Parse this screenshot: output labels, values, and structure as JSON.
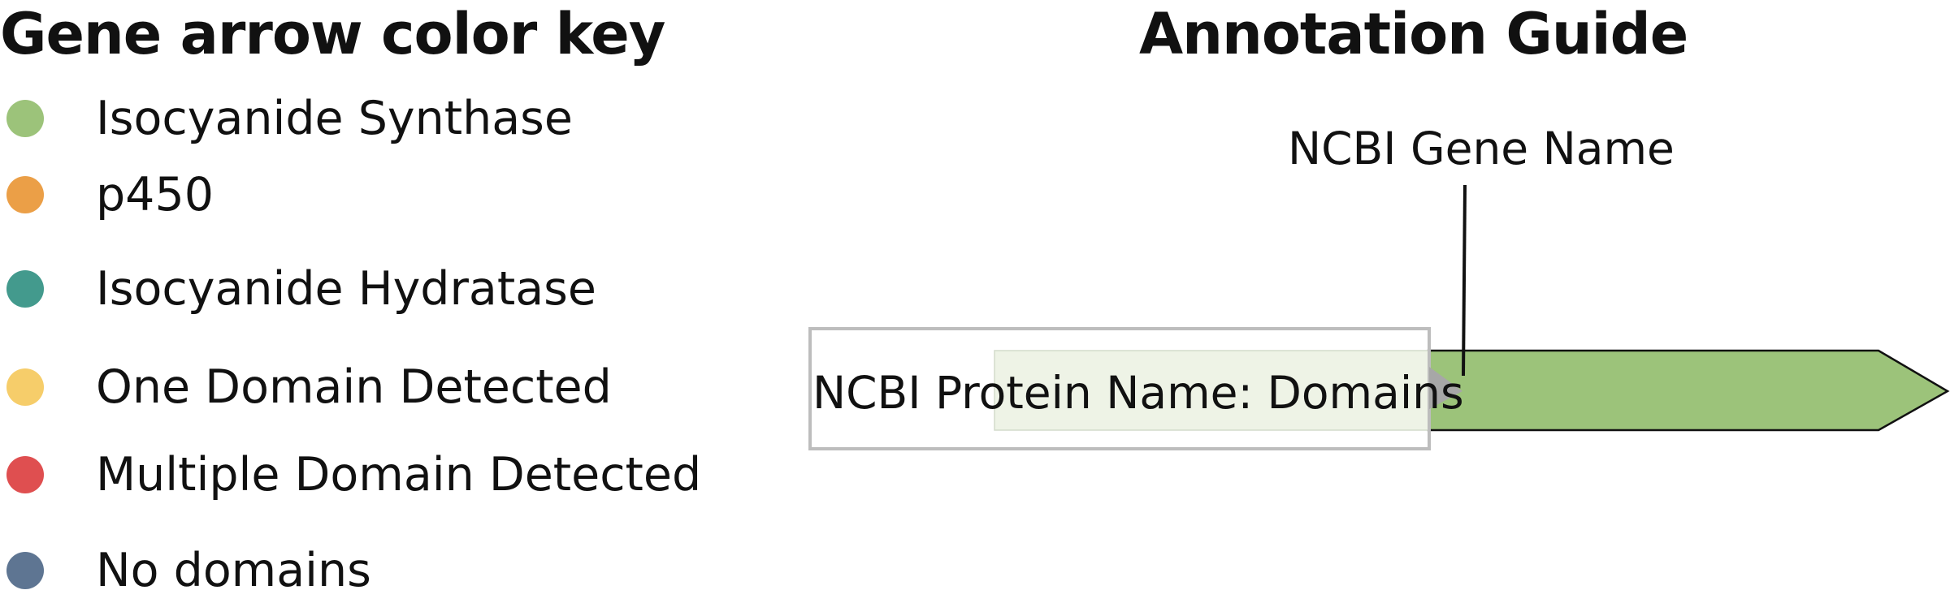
{
  "legend": {
    "title": "Gene arrow color key",
    "items": [
      {
        "label": "Isocyanide Synthase",
        "color": "#9cc37a"
      },
      {
        "label": "p450",
        "color": "#eb9f47"
      },
      {
        "label": "Isocyanide Hydratase",
        "color": "#439a8d"
      },
      {
        "label": "One Domain Detected",
        "color": "#f6cd6a"
      },
      {
        "label": "Multiple Domain Detected",
        "color": "#df4f50"
      },
      {
        "label": "No domains",
        "color": "#5e7592"
      }
    ]
  },
  "guide": {
    "title": "Annotation Guide",
    "gene_name_label": "NCBI Gene Name",
    "protein_label": "NCBI Protein Name: Domains",
    "arrow_color": "#9cc37a"
  }
}
